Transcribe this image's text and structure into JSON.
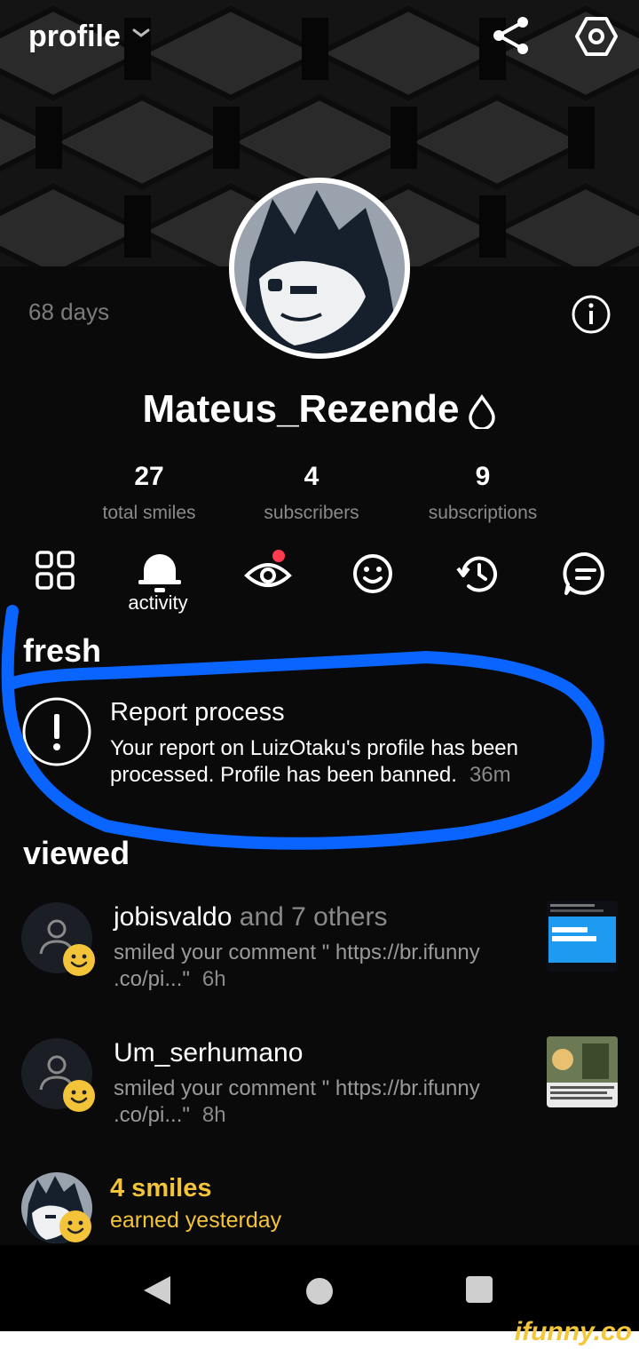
{
  "header": {
    "title": "profile",
    "days": "68 days"
  },
  "profile": {
    "username": "Mateus_Rezende",
    "stats": [
      {
        "value": "27",
        "label": "total smiles"
      },
      {
        "value": "4",
        "label": "subscribers"
      },
      {
        "value": "9",
        "label": "subscriptions"
      }
    ]
  },
  "tabs": {
    "active_label": "activity",
    "icons": [
      "grid-icon",
      "bell-icon",
      "eye-icon",
      "smiley-icon",
      "history-icon",
      "comment-icon"
    ]
  },
  "sections": {
    "fresh": "fresh",
    "viewed": "viewed"
  },
  "report": {
    "title": "Report process",
    "body": "Your report on LuizOtaku's profile has been processed. Profile has been banned.",
    "time": "36m"
  },
  "notifications": [
    {
      "name": "jobisvaldo",
      "suffix": " and 7 others",
      "body": "smiled your comment \" https://br.ifunny .co/pi...\"",
      "time": "6h"
    },
    {
      "name": "Um_serhumano",
      "suffix": "",
      "body": "smiled your comment \" https://br.ifunny .co/pi...\"",
      "time": "8h"
    }
  ],
  "smiles_earned": {
    "title": "4 smiles",
    "subtitle": "earned yesterday"
  },
  "watermark": "ifunny.co",
  "colors": {
    "accent_yellow": "#f3c43a",
    "highlight_blue": "#0a64ff",
    "notification_dot": "#ff3b4e"
  }
}
